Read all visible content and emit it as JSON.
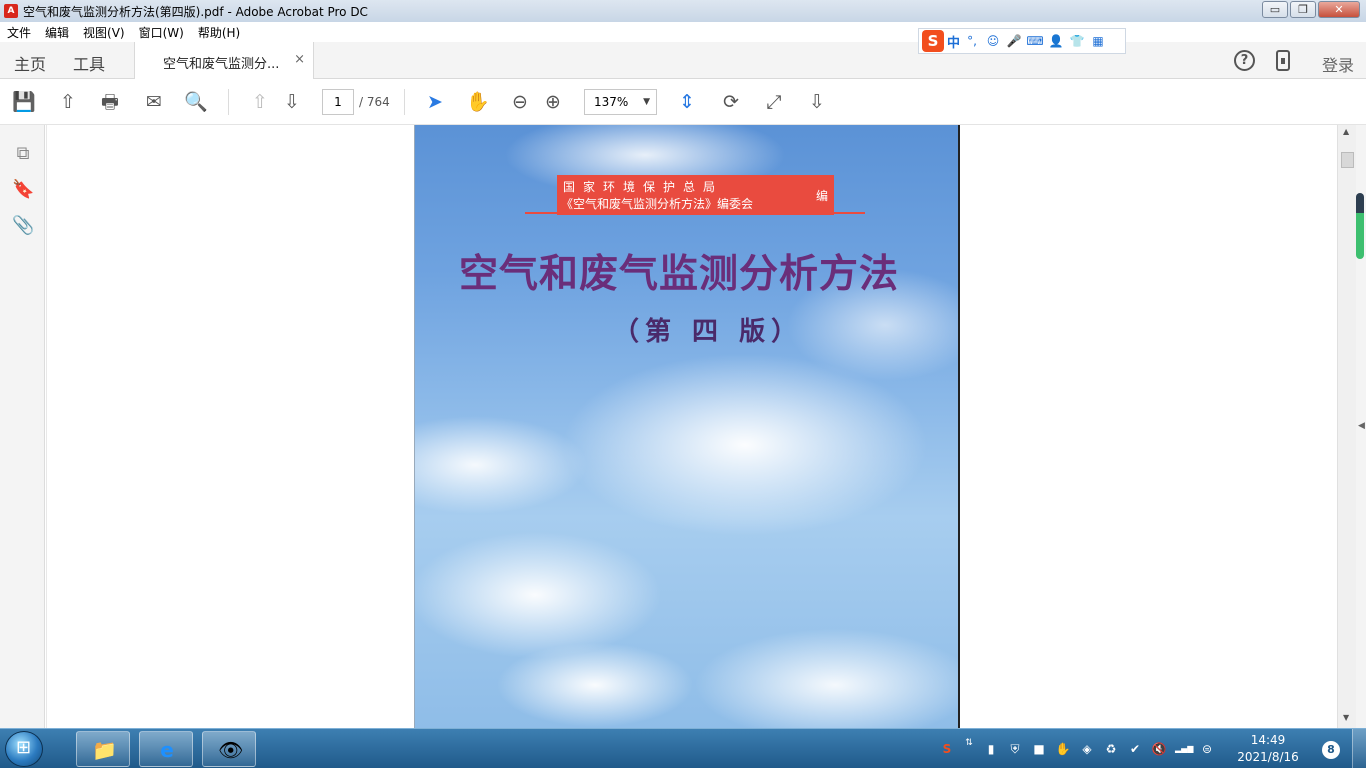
{
  "window": {
    "app_icon_label": "A",
    "title": "空气和废气监测分析方法(第四版).pdf - Adobe Acrobat Pro DC",
    "controls": {
      "minimize": "▭",
      "maximize": "❐",
      "close": "✕"
    }
  },
  "menu": {
    "items": [
      "文件",
      "编辑",
      "视图(V)",
      "窗口(W)",
      "帮助(H)"
    ]
  },
  "ime": {
    "logo": "S",
    "mode": "中",
    "punct": "°,",
    "emoji": "☺",
    "mic": "🎤",
    "keyboard": "⌨",
    "user": "👤",
    "skin": "👕",
    "grid": "▦"
  },
  "tabs": {
    "home": "主页",
    "tools": "工具",
    "document": "空气和废气监测分...",
    "close": "×",
    "help": "?",
    "login": "登录"
  },
  "toolbar": {
    "icons": {
      "save": "💾",
      "upload": "⇧",
      "print": "🖶",
      "email": "✉",
      "search": "🔍",
      "prev": "⇧",
      "next": "⇩",
      "select": "➤",
      "hand": "✋",
      "zoom_out": "⊖",
      "zoom_in": "⊕",
      "fit": "⇕",
      "rotate": "⟳",
      "fullscreen": "⤢",
      "read": "⇩"
    },
    "page_current": "1",
    "page_total": "/ 764",
    "zoom": "137%",
    "zoom_arrow": "▼"
  },
  "leftpanel": {
    "pages_icon": "⧉",
    "bookmark_icon": "🔖",
    "attach_icon": "📎",
    "collapse": "◀"
  },
  "cover": {
    "publisher_line1": "国家环境保护总局",
    "publisher_line2": "《空气和废气监测分析方法》编委会",
    "publisher_suffix": "编",
    "title": "空气和废气监测分析方法",
    "edition": "（第 四 版）"
  },
  "scroll": {
    "up": "▲",
    "down": "▼",
    "right_arrow": "◀"
  },
  "taskbar": {
    "apps": [
      {
        "name": "explorer",
        "glyph": "📁"
      },
      {
        "name": "ie",
        "glyph": "e"
      },
      {
        "name": "screen-tool",
        "glyph": "👁"
      }
    ],
    "tray_icons": [
      "S",
      "⇅",
      "▮",
      "⛨",
      "■",
      "✋",
      "◈",
      "♻",
      "✔",
      "🔇",
      "▂▄▆",
      "⊜"
    ],
    "time": "14:49",
    "date": "2021/8/16",
    "notify_count": "8"
  },
  "colors": {
    "title_purple": "#6a2e7a",
    "banner_red": "#e94b3f",
    "accent_blue": "#2a7ae2"
  }
}
